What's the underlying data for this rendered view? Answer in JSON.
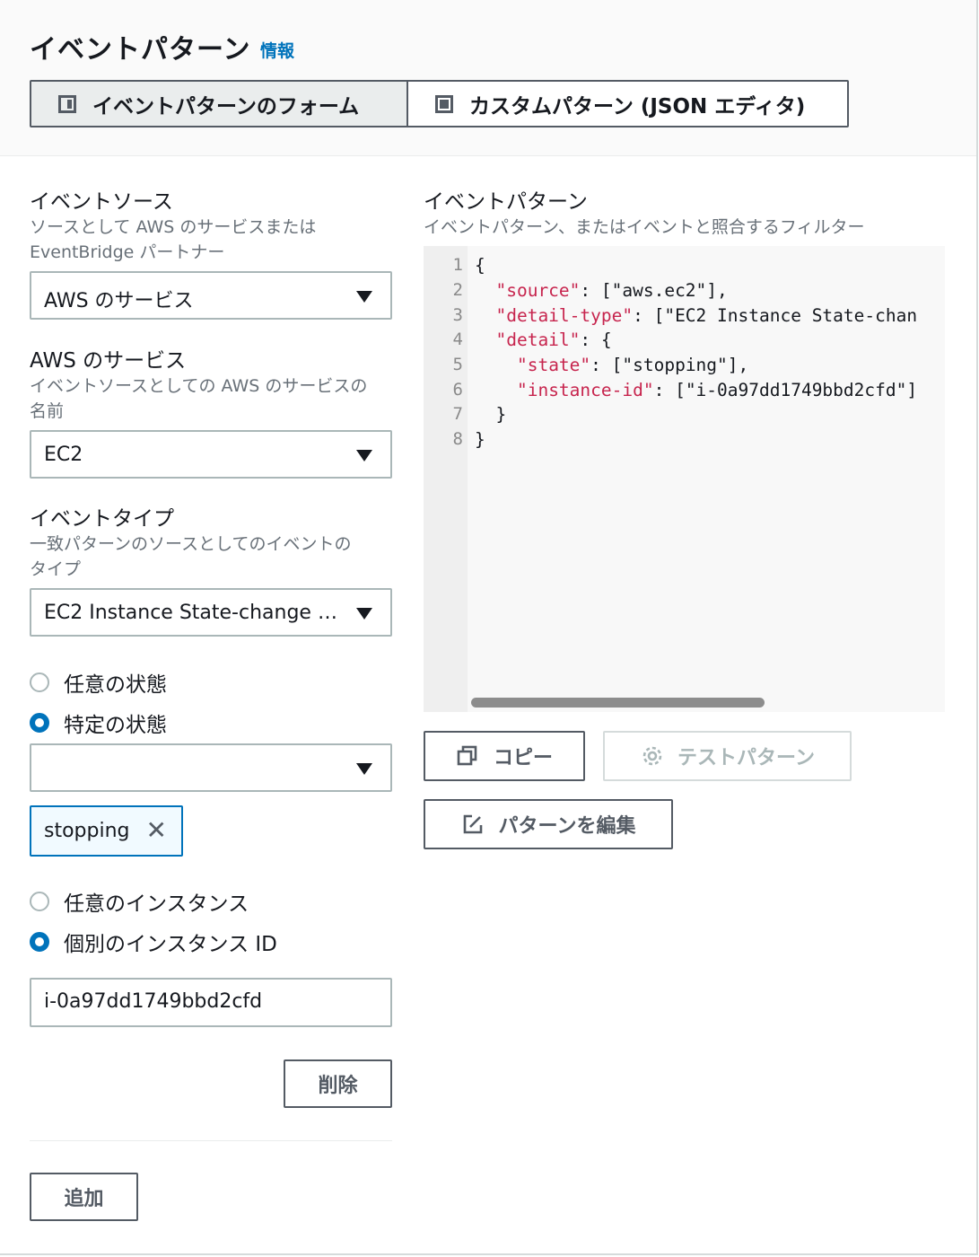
{
  "header": {
    "title": "イベントパターン",
    "info_link": "情報",
    "tabs": [
      {
        "label": "イベントパターンのフォーム",
        "selected": true
      },
      {
        "label": "カスタムパターン (JSON エディタ)",
        "selected": false
      }
    ]
  },
  "form": {
    "event_source": {
      "label": "イベントソース",
      "desc1": "ソースとして AWS のサービスまたは",
      "desc2": "EventBridge パートナー",
      "value": "AWS のサービス"
    },
    "aws_service": {
      "label": "AWS のサービス",
      "desc1": "イベントソースとしての AWS のサービスの",
      "desc2": "名前",
      "value": "EC2"
    },
    "event_type": {
      "label": "イベントタイプ",
      "desc1": "一致パターンのソースとしてのイベントの",
      "desc2": "タイプ",
      "value": "EC2 Instance State-change …"
    },
    "state_options": [
      {
        "label": "任意の状態",
        "selected": false
      },
      {
        "label": "特定の状態",
        "selected": true
      }
    ],
    "state_select_value": "",
    "state_token": "stopping",
    "instance_options": [
      {
        "label": "任意のインスタンス",
        "selected": false
      },
      {
        "label": "個別のインスタンス ID",
        "selected": true
      }
    ],
    "instance_id_value": "i-0a97dd1749bbd2cfd",
    "remove_button": "削除",
    "add_button": "追加"
  },
  "pattern": {
    "label": "イベントパターン",
    "desc": "イベントパターン、またはイベントと照合するフィルター",
    "line_numbers": [
      "1",
      "2",
      "3",
      "4",
      "5",
      "6",
      "7",
      "8"
    ],
    "code": {
      "l1": "{",
      "l2_key": "\"source\"",
      "l2_rest": ": [\"aws.ec2\"],",
      "l3_key": "\"detail-type\"",
      "l3_rest": ": [\"EC2 Instance State-chan",
      "l4_key": "\"detail\"",
      "l4_rest": ": {",
      "l5_key": "\"state\"",
      "l5_rest": ": [\"stopping\"],",
      "l6_key": "\"instance-id\"",
      "l6_rest": ": [\"i-0a97dd1749bbd2cfd\"]",
      "l7": "}",
      "l8": "}"
    },
    "copy_button": "コピー",
    "test_button": "テストパターン",
    "edit_button": "パターンを編集"
  }
}
